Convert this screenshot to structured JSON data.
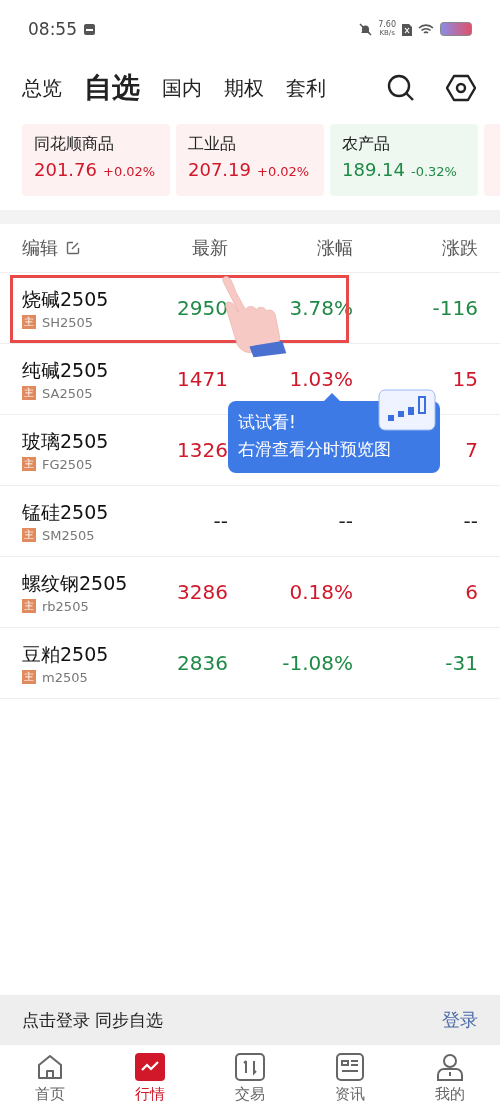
{
  "status_bar": {
    "time": "08:55",
    "speed_value": "7.60",
    "speed_unit": "KB/s"
  },
  "tabs": [
    {
      "label": "总览",
      "selected": false
    },
    {
      "label": "自选",
      "selected": true
    },
    {
      "label": "国内",
      "selected": false
    },
    {
      "label": "期权",
      "selected": false
    },
    {
      "label": "套利",
      "selected": false
    }
  ],
  "index_cards": [
    {
      "name": "同花顺商品",
      "value": "201.76",
      "change": "+0.02%",
      "kind": "up"
    },
    {
      "name": "工业品",
      "value": "207.19",
      "change": "+0.02%",
      "kind": "up"
    },
    {
      "name": "农产品",
      "value": "189.14",
      "change": "-0.32%",
      "kind": "down"
    }
  ],
  "table": {
    "columns": [
      "编辑",
      "最新",
      "涨幅",
      "涨跌"
    ],
    "rows": [
      {
        "name": "烧碱2505",
        "badge": "主",
        "code": "SH2505",
        "price": "2950",
        "pct": "3.78%",
        "change": "-116",
        "kind": "down",
        "highlighted": true
      },
      {
        "name": "纯碱2505",
        "badge": "主",
        "code": "SA2505",
        "price": "1471",
        "pct": "1.03%",
        "change": "15",
        "kind": "up",
        "highlighted": false
      },
      {
        "name": "玻璃2505",
        "badge": "主",
        "code": "FG2505",
        "price": "1326",
        "change": "7",
        "kind": "up",
        "highlighted": false
      },
      {
        "name": "锰硅2505",
        "badge": "主",
        "code": "SM2505",
        "price": "--",
        "pct": "--",
        "change": "--",
        "kind": "flat",
        "highlighted": false
      },
      {
        "name": "螺纹钢2505",
        "badge": "主",
        "code": "rb2505",
        "price": "3286",
        "pct": "0.18%",
        "change": "6",
        "kind": "up",
        "highlighted": false
      },
      {
        "name": "豆粕2505",
        "badge": "主",
        "code": "m2505",
        "price": "2836",
        "pct": "-1.08%",
        "change": "-31",
        "kind": "down",
        "highlighted": false
      }
    ]
  },
  "tooltip": {
    "title": "试试看!",
    "text": "右滑查看分时预览图"
  },
  "login_bar": {
    "text": "点击登录 同步自选",
    "action": "登录"
  },
  "bottom_nav": [
    {
      "label": "首页",
      "selected": false
    },
    {
      "label": "行情",
      "selected": true
    },
    {
      "label": "交易",
      "selected": false
    },
    {
      "label": "资讯",
      "selected": false
    },
    {
      "label": "我的",
      "selected": false
    }
  ]
}
